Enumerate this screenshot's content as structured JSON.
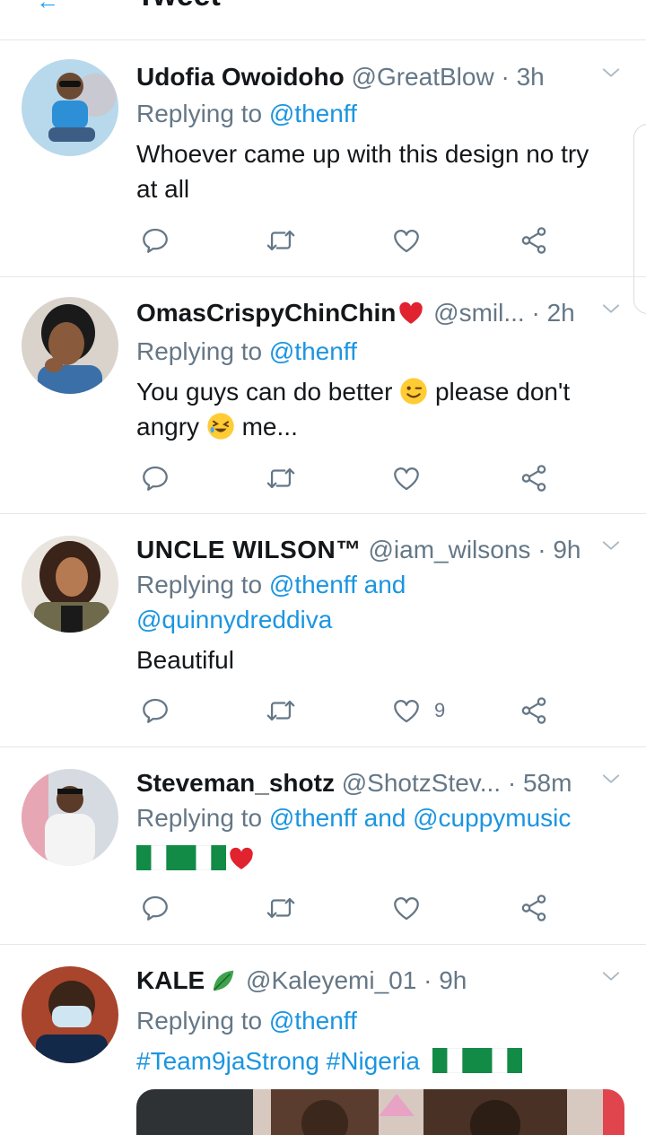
{
  "header": {
    "title": "Tweet"
  },
  "tweets": [
    {
      "name": "Udofia Owoidoho",
      "handle": "@GreatBlow",
      "time": "3h",
      "replying_prefix": "Replying to",
      "replying_to": "@thenff",
      "text_line1": "Whoever came up with this design no try",
      "text_line2": "at all"
    },
    {
      "name": "OmasCrispyChinChin",
      "handle": "@smil...",
      "time": "2h",
      "replying_prefix": "Replying to",
      "replying_to": "@thenff",
      "text_line1_a": "You guys can do better",
      "text_line1_b": "please don't",
      "text_line2_a": "angry",
      "text_line2_b": "me..."
    },
    {
      "name": "UNCLE WILSON™",
      "handle": "@iam_wilsons",
      "time": "9h",
      "replying_prefix": "Replying to",
      "replying_to": "@thenff and",
      "replying_to_2": "@quinnydreddiva",
      "text_line1": "Beautiful",
      "like_count": "9"
    },
    {
      "name": "Steveman_shotz",
      "handle": "@ShotzStev...",
      "time": "58m",
      "replying_prefix": "Replying to",
      "replying_to": "@thenff and @cuppymusic"
    },
    {
      "name": "KALE",
      "handle": "@Kaleyemi_01",
      "time": "9h",
      "replying_prefix": "Replying to",
      "replying_to": "@thenff",
      "hashtags": "#Team9jaStrong #Nigeria"
    }
  ],
  "dot": "·",
  "icons": {
    "reply": "reply-icon",
    "retweet": "retweet-icon",
    "like": "heart-icon",
    "share": "share-icon",
    "more": "chevron-down-icon"
  },
  "colors": {
    "link": "#1b95e0",
    "secondary": "#657786",
    "text": "#14171a",
    "divider": "#e1e8ed"
  }
}
